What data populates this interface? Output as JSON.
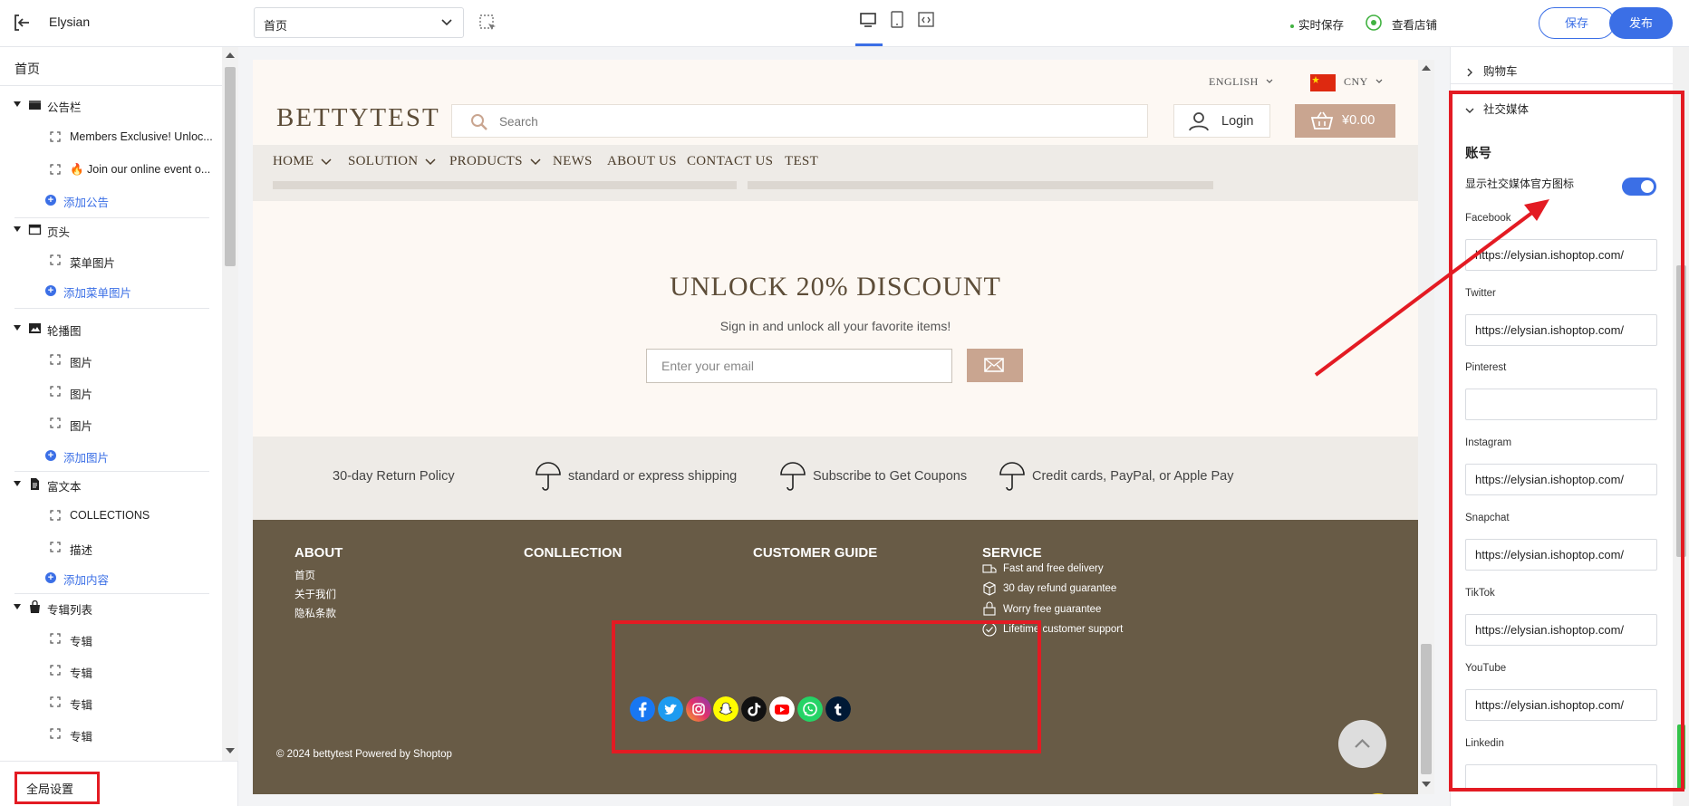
{
  "topbar": {
    "app_title": "Elysian",
    "page_select_value": "首页",
    "autosave": "实时保存",
    "view_store": "查看店铺",
    "save": "保存",
    "publish": "发布"
  },
  "left_panel": {
    "home": "首页",
    "groups": [
      {
        "label": "公告栏",
        "children": [
          "Members Exclusive! Unloc...",
          "🔥 Join our online event o..."
        ],
        "add": "添加公告"
      },
      {
        "label": "页头",
        "children": [
          "菜单图片"
        ],
        "add": "添加菜单图片"
      },
      {
        "label": "轮播图",
        "children": [
          "图片",
          "图片",
          "图片"
        ],
        "add": "添加图片"
      },
      {
        "label": "富文本",
        "children": [
          "COLLECTIONS",
          "描述"
        ],
        "add": "添加内容"
      },
      {
        "label": "专辑列表",
        "children": [
          "专辑",
          "专辑",
          "专辑",
          "专辑"
        ],
        "add": ""
      }
    ],
    "global_settings": "全局设置"
  },
  "store": {
    "language": "ENGLISH",
    "currency": "CNY",
    "brand": "BETTYTEST",
    "search_placeholder": "Search",
    "login": "Login",
    "cart_total": "¥0.00",
    "nav": [
      "HOME",
      "SOLUTION",
      "PRODUCTS",
      "NEWS",
      "ABOUT US",
      "CONTACT US",
      "TEST"
    ],
    "discount_title": "UNLOCK 20% DISCOUNT",
    "discount_subtitle": "Sign in and unlock all your favorite items!",
    "email_placeholder": "Enter your email",
    "features": [
      "30-day Return Policy",
      "standard or express shipping",
      "Subscribe to Get Coupons",
      "Credit cards, PayPal, or Apple Pay"
    ],
    "footer": {
      "about_title": "ABOUT",
      "about_links": [
        "首页",
        "关于我们",
        "隐私条款"
      ],
      "collection_title": "CONLLECTION",
      "guide_title": "CUSTOMER GUIDE",
      "service_title": "SERVICE",
      "service_items": [
        "Fast and free delivery",
        "30 day refund guarantee",
        "Worry free guarantee",
        "Lifetime customer support"
      ],
      "social_icons": [
        "facebook-icon",
        "twitter-icon",
        "instagram-icon",
        "snapchat-icon",
        "tiktok-icon",
        "youtube-icon",
        "whatsapp-icon",
        "tumblr-icon"
      ],
      "copyright": "© 2024 bettytest  Powered by Shoptop"
    }
  },
  "right_panel": {
    "cart_section": "购物车",
    "social_section": "社交媒体",
    "account_title": "账号",
    "show_icons_label": "显示社交媒体官方图标",
    "show_icons_enabled": true,
    "fields": [
      {
        "label": "Facebook",
        "value": "https://elysian.ishoptop.com/"
      },
      {
        "label": "Twitter",
        "value": "https://elysian.ishoptop.com/"
      },
      {
        "label": "Pinterest",
        "value": ""
      },
      {
        "label": "Instagram",
        "value": "https://elysian.ishoptop.com/"
      },
      {
        "label": "Snapchat",
        "value": "https://elysian.ishoptop.com/"
      },
      {
        "label": "TikTok",
        "value": "https://elysian.ishoptop.com/"
      },
      {
        "label": "YouTube",
        "value": "https://elysian.ishoptop.com/"
      },
      {
        "label": "Linkedin",
        "value": ""
      }
    ]
  },
  "colors": {
    "accent": "#3b6fe6",
    "annotation_red": "#e31b23",
    "footer_bg": "#685b46",
    "brand_tan": "#c9a590"
  }
}
